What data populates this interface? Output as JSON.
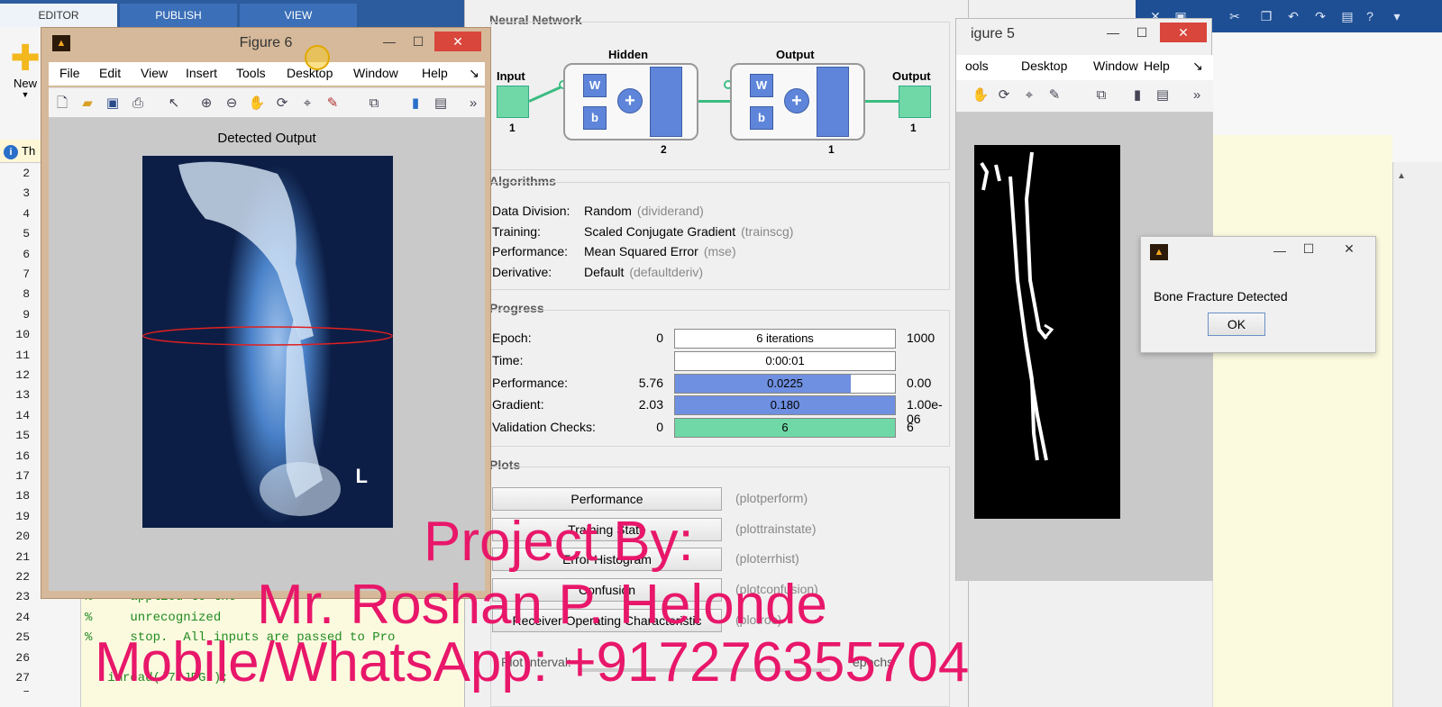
{
  "matlab": {
    "tabs": [
      "EDITOR",
      "PUBLISH",
      "VIEW"
    ],
    "new_label": "New",
    "info_text": "Th",
    "line_numbers": [
      "2",
      "3",
      "4",
      "5",
      "6",
      "7",
      "8",
      "9",
      "10",
      "11",
      "12",
      "13",
      "14",
      "15",
      "16",
      "17",
      "18",
      "19",
      "20",
      "21",
      "22",
      "23",
      "24",
      "25",
      "26",
      "27 –"
    ],
    "code_lines": [
      {
        "line": "23",
        "text": "%     applied to the"
      },
      {
        "line": "24",
        "text": "%     unrecognized"
      },
      {
        "line": "25",
        "text": "%     stop.  All inputs are passed to Pro"
      },
      {
        "line": "27 –",
        "text": "   imread('7.JPG');"
      }
    ]
  },
  "figure6": {
    "title": "Figure 6",
    "menu": [
      "File",
      "Edit",
      "View",
      "Insert",
      "Tools",
      "Desktop",
      "Window",
      "Help"
    ],
    "axes_title": "Detected Output",
    "xray_marker": "L"
  },
  "figure5": {
    "title": "igure 5",
    "menu": [
      "ools",
      "Desktop",
      "Window",
      "Help"
    ]
  },
  "nntool": {
    "nn_title": "Neural Network",
    "input_label": "Input",
    "input_size": "1",
    "hidden_label": "Hidden",
    "hidden_size": "2",
    "output_layer_label": "Output",
    "output_layer_size": "1",
    "output_label": "Output",
    "output_size": "1",
    "w": "W",
    "b": "b",
    "plus": "+",
    "algorithms_title": "Algorithms",
    "algorithms": [
      {
        "key": "Data Division:",
        "value": "Random",
        "fn": "(dividerand)"
      },
      {
        "key": "Training:",
        "value": "Scaled Conjugate Gradient",
        "fn": "(trainscg)"
      },
      {
        "key": "Performance:",
        "value": "Mean Squared Error",
        "fn": "(mse)"
      },
      {
        "key": "Derivative:",
        "value": "Default",
        "fn": "(defaultderiv)"
      }
    ],
    "progress_title": "Progress",
    "progress": [
      {
        "key": "Epoch:",
        "start": "0",
        "text": "6 iterations",
        "end": "1000",
        "fill": 0.0,
        "color": "#ffffff"
      },
      {
        "key": "Time:",
        "start": "",
        "text": "0:00:01",
        "end": "",
        "fill": 0.0,
        "color": "#ffffff"
      },
      {
        "key": "Performance:",
        "start": "5.76",
        "text": "0.0225",
        "end": "0.00",
        "fill": 0.8,
        "color": "#6f8fe0"
      },
      {
        "key": "Gradient:",
        "start": "2.03",
        "text": "0.180",
        "end": "1.00e-06",
        "fill": 1.0,
        "color": "#6f8fe0"
      },
      {
        "key": "Validation Checks:",
        "start": "0",
        "text": "6",
        "end": "6",
        "fill": 1.0,
        "color": "#6fd8a6"
      }
    ],
    "plots_title": "Plots",
    "plots": [
      {
        "label": "Performance",
        "fn": "(plotperform)"
      },
      {
        "label": "Training State",
        "fn": "(plottrainstate)"
      },
      {
        "label": "Error Histogram",
        "fn": "(ploterrhist)"
      },
      {
        "label": "Confusion",
        "fn": "(plotconfusion)"
      },
      {
        "label": "Receiver Operating Characteristic",
        "fn": "(plotroc)"
      }
    ],
    "plot_interval_label": "Plot Interval:",
    "plot_interval_unit": "epochs"
  },
  "msgbox": {
    "message": "Bone Fracture Detected",
    "ok_label": "OK"
  },
  "overlay": {
    "line1": "Project By:",
    "line2": "Mr. Roshan P. Helonde",
    "line3": "Mobile/WhatsApp: +917276355704"
  },
  "colors": {
    "overlay": "#e8176a",
    "nn_green": "#6fd8a6",
    "nn_blue": "#5e85d9",
    "close_red": "#d9463c"
  }
}
